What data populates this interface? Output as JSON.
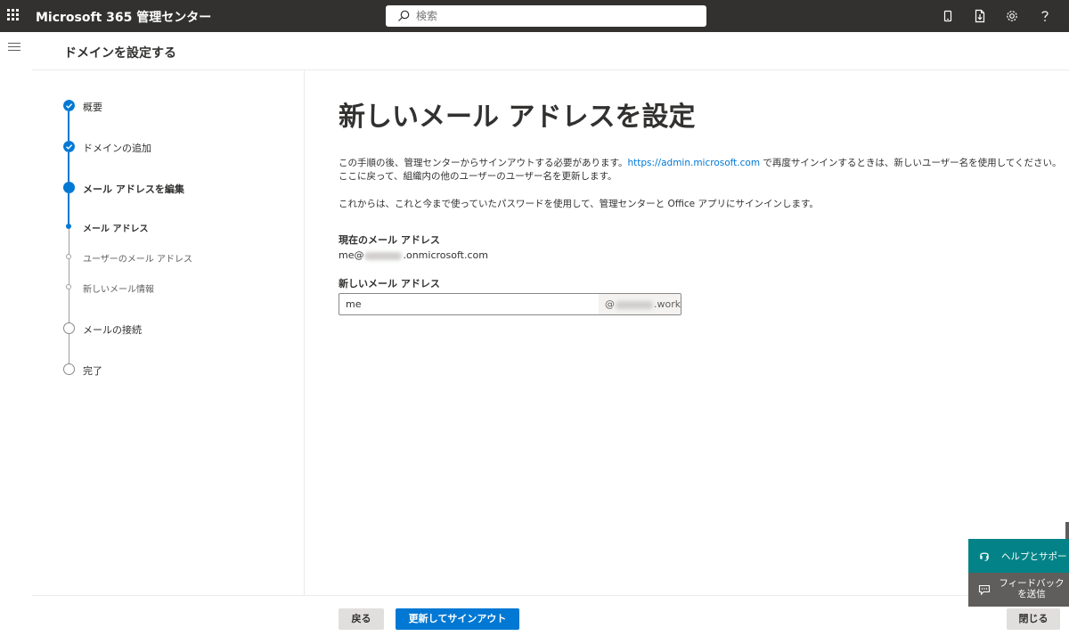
{
  "topbar": {
    "app_title": "Microsoft 365 管理センター",
    "search_placeholder": "検索"
  },
  "header": {
    "title": "ドメインを設定する"
  },
  "stepper": {
    "steps": [
      {
        "label": "概要",
        "state": "complete"
      },
      {
        "label": "ドメインの追加",
        "state": "complete"
      },
      {
        "label": "メール アドレスを編集",
        "state": "current"
      },
      {
        "label": "メール アドレス",
        "state": "current-sub"
      },
      {
        "label": "ユーザーのメール アドレス",
        "state": "pending-sub"
      },
      {
        "label": "新しいメール情報",
        "state": "pending-sub"
      },
      {
        "label": "メールの接続",
        "state": "pending"
      },
      {
        "label": "完了",
        "state": "pending"
      }
    ]
  },
  "main": {
    "heading": "新しいメール アドレスを設定",
    "para1_before_link": "この手順の後、管理センターからサインアウトする必要があります。",
    "para1_link": "https://admin.microsoft.com",
    "para1_after_link": " で再度サインインするときは、新しいユーザー名を使用してください。",
    "para1_line2": "ここに戻って、組織内の他のユーザーのユーザー名を更新します。",
    "para2": "これからは、これと今まで使っていたパスワードを使用して、管理センターと Office アプリにサインインします。",
    "current_email_label": "現在のメール アドレス",
    "current_email_prefix": "me@",
    "current_email_suffix": ".onmicrosoft.com",
    "new_email_label": "新しいメール アドレス",
    "new_email_value": "me",
    "new_email_domain_prefix": "@",
    "new_email_domain_suffix": ".work"
  },
  "footer": {
    "back_label": "戻る",
    "primary_label": "更新してサインアウト",
    "close_label": "閉じる"
  },
  "floating": {
    "help_label": "ヘルプとサポー",
    "feedback_line1": "フィードバック",
    "feedback_line2": "を送信"
  },
  "colors": {
    "topbar": "#323130",
    "accent": "#0078d4",
    "help": "#038387",
    "feedback": "#605e5c"
  }
}
